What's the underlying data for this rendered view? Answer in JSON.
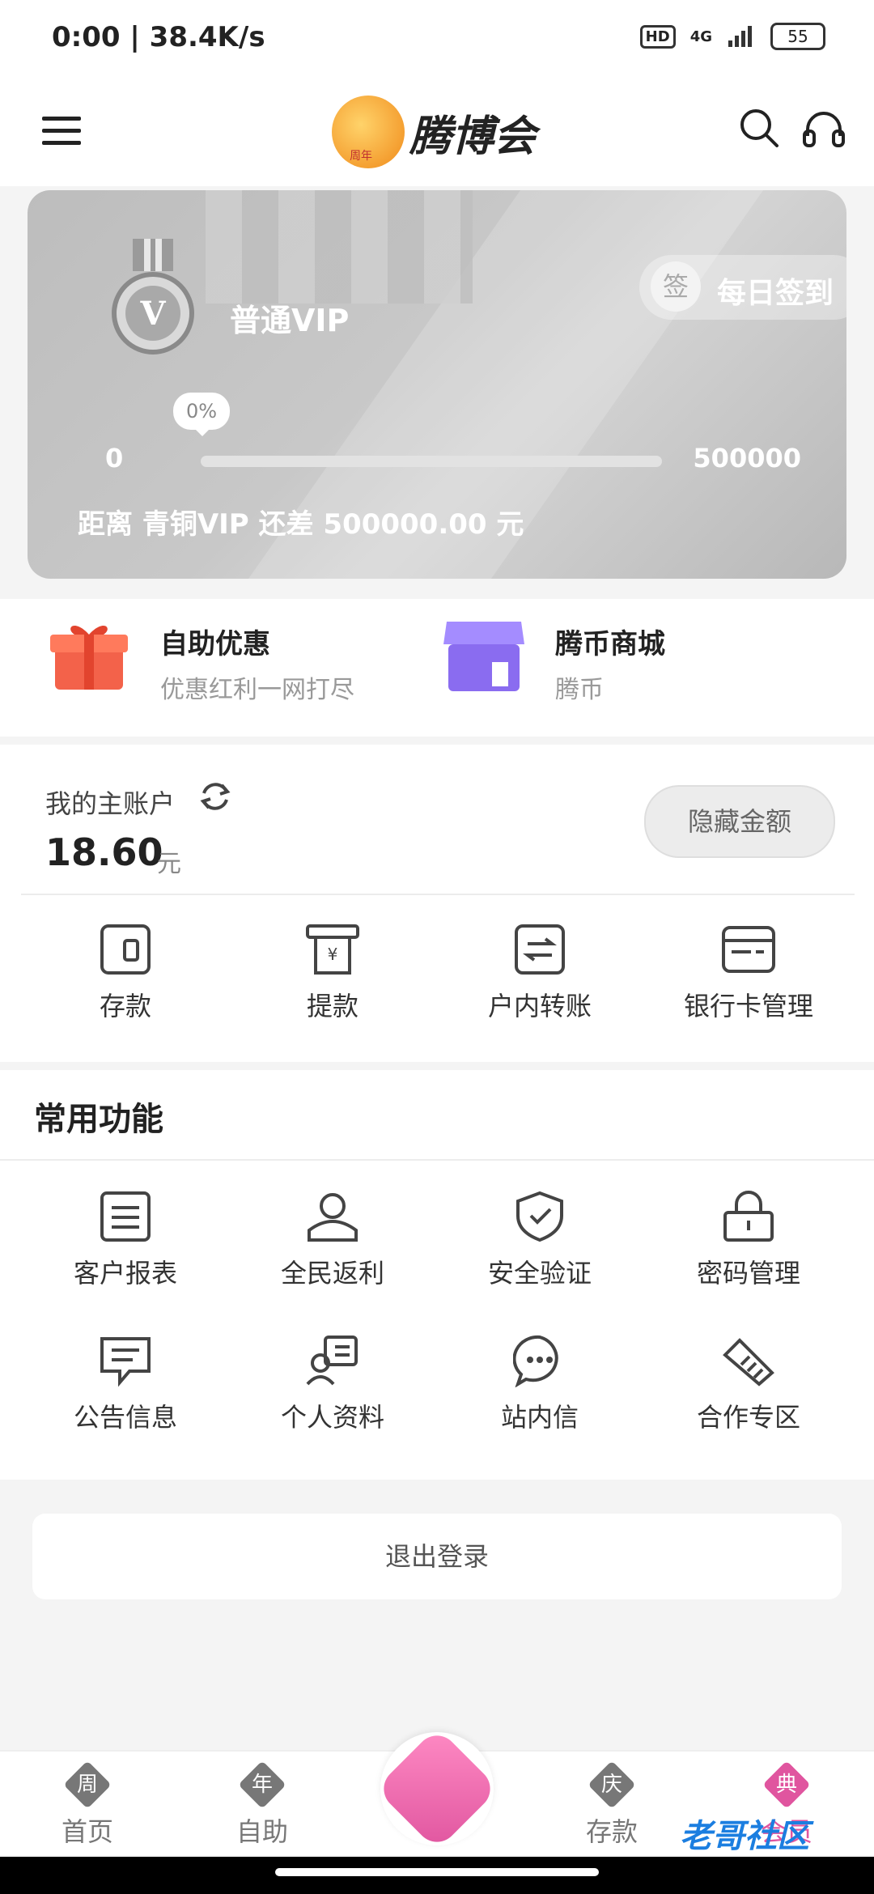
{
  "status_bar": {
    "time": "0:00 | 38.4K/s",
    "battery": "55",
    "hd": "HD",
    "network": "4G"
  },
  "header": {
    "brand": "腾博会",
    "logo_badge": "周年"
  },
  "vip_card": {
    "level_label": "普通VIP",
    "sign_in_glyph": "签",
    "sign_in_label": "每日签到",
    "progress_percent_text": "0%",
    "progress_fraction": 0.0,
    "range_min": "0",
    "range_max": "500000",
    "note": "距离 青铜VIP 还差 500000.00 元",
    "medal_glyph": "V"
  },
  "promos": [
    {
      "title": "自助优惠",
      "subtitle": "优惠红利一网打尽"
    },
    {
      "title": "腾币商城",
      "subtitle": "腾币"
    }
  ],
  "account": {
    "label": "我的主账户",
    "amount": "18.60",
    "unit": "元",
    "hide_button": "隐藏金额",
    "actions": [
      "存款",
      "提款",
      "户内转账",
      "银行卡管理"
    ]
  },
  "common": {
    "title": "常用功能",
    "items": [
      "客户报表",
      "全民返利",
      "安全验证",
      "密码管理",
      "公告信息",
      "个人资料",
      "站内信",
      "合作专区"
    ]
  },
  "logout_label": "退出登录",
  "tabbar": {
    "tabs": [
      {
        "glyph": "周",
        "label": "首页"
      },
      {
        "glyph": "年",
        "label": "自助"
      },
      {
        "glyph": "庆",
        "label": "存款"
      },
      {
        "glyph": "典",
        "label": "会员"
      }
    ]
  },
  "watermark": "老哥社区",
  "colors": {
    "accent": "#e0559f",
    "card_gray": "#c4c4c4"
  }
}
